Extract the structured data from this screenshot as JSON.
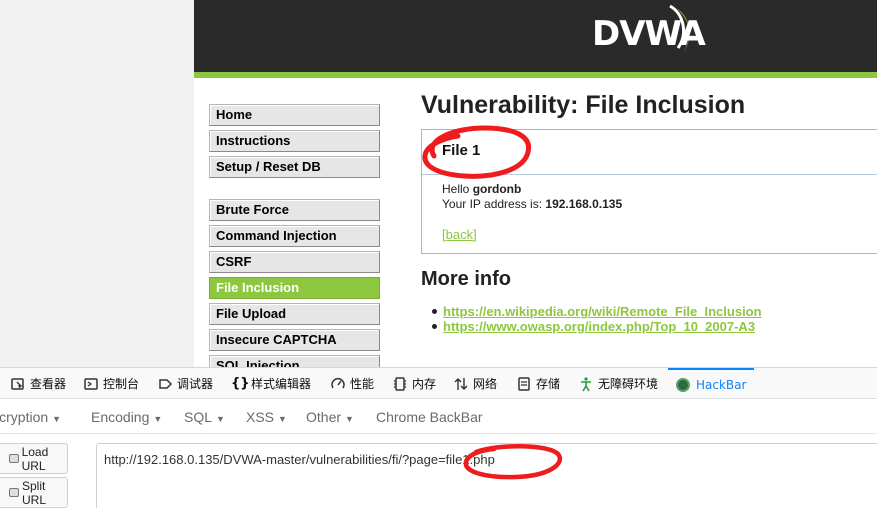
{
  "dvwa": {
    "logo_text": "DVWA",
    "accent_color": "#8dc63f",
    "menu_group1": [
      {
        "label": "Home"
      },
      {
        "label": "Instructions"
      },
      {
        "label": "Setup / Reset DB"
      }
    ],
    "menu_group2": [
      {
        "label": "Brute Force"
      },
      {
        "label": "Command Injection"
      },
      {
        "label": "CSRF"
      },
      {
        "label": "File Inclusion",
        "selected": true
      },
      {
        "label": "File Upload"
      },
      {
        "label": "Insecure CAPTCHA"
      },
      {
        "label": "SQL Injection"
      }
    ],
    "title": "Vulnerability: File Inclusion",
    "box": {
      "heading": "File 1",
      "hello_prefix": "Hello ",
      "username": "gordonb",
      "ip_prefix": "Your IP address is: ",
      "ip": "192.168.0.135",
      "back_open": "[",
      "back_label": "back",
      "back_close": "]"
    },
    "more_info_title": "More info",
    "more_info_links": [
      "https://en.wikipedia.org/wiki/Remote_File_Inclusion",
      "https://www.owasp.org/index.php/Top_10_2007-A3"
    ]
  },
  "devtools": {
    "tabs": [
      {
        "label": "查看器",
        "icon": "inspector-icon"
      },
      {
        "label": "控制台",
        "icon": "console-icon"
      },
      {
        "label": "调试器",
        "icon": "debugger-icon"
      },
      {
        "label": "样式编辑器",
        "icon": "style-editor-icon"
      },
      {
        "label": "性能",
        "icon": "performance-icon"
      },
      {
        "label": "内存",
        "icon": "memory-icon"
      },
      {
        "label": "网络",
        "icon": "network-icon"
      },
      {
        "label": "存储",
        "icon": "storage-icon"
      },
      {
        "label": "无障碍环境",
        "icon": "accessibility-icon"
      },
      {
        "label": "HackBar",
        "icon": "hackbar-icon",
        "active": true
      }
    ]
  },
  "hackbar": {
    "menus": [
      "Encryption",
      "Encoding",
      "SQL",
      "XSS",
      "Other",
      "Chrome BackBar"
    ],
    "load_url": "Load URL",
    "split_url": "Split URL",
    "url_value": "http://192.168.0.135/DVWA-master/vulnerabilities/fi/?page=file1.php"
  }
}
